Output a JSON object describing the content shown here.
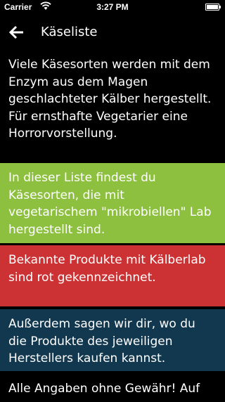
{
  "status_bar": {
    "carrier": "Carrier",
    "time": "3:27 PM"
  },
  "nav": {
    "title": "Käseliste"
  },
  "blocks": [
    {
      "text": "Viele Käsesorten werden mit dem Enzym aus dem Magen geschlachteter Kälber hergestellt. Für ernsthafte Vegetarier eine Horrorvorstellung.",
      "color": "#000000"
    },
    {
      "text": "In dieser Liste findest du Käsesorten, die mit vegetarischem \"mikrobiellen\" Lab hergestellt sind.",
      "color": "#8dc03f"
    },
    {
      "text": "Bekannte Produkte mit Kälberlab sind rot gekennzeichnet.",
      "color": "#cc3233"
    },
    {
      "text": "Außerdem sagen wir dir, wo du die Produkte des jeweiligen Herstellers kaufen kannst.",
      "color": "#12384f"
    },
    {
      "text": "Alle Angaben ohne Gewähr! Auf",
      "color": "#000000"
    }
  ]
}
